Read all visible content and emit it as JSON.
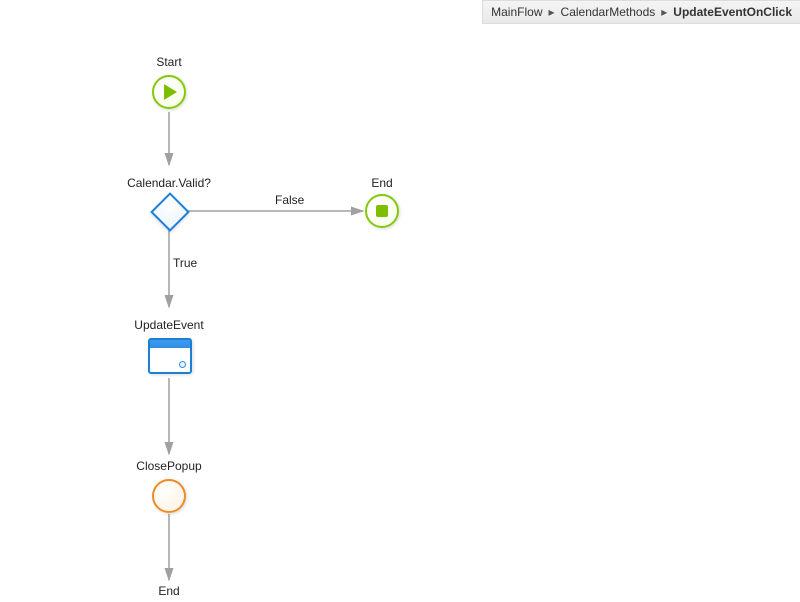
{
  "breadcrumb": {
    "level1": "MainFlow",
    "level2": "CalendarMethods",
    "level3": "UpdateEventOnClick"
  },
  "nodes": {
    "start": "Start",
    "decision": "Calendar.Valid?",
    "end1": "End",
    "updateEvent": "UpdateEvent",
    "closePopup": "ClosePopup",
    "end2": "End"
  },
  "edges": {
    "falseLabel": "False",
    "trueLabel": "True"
  }
}
